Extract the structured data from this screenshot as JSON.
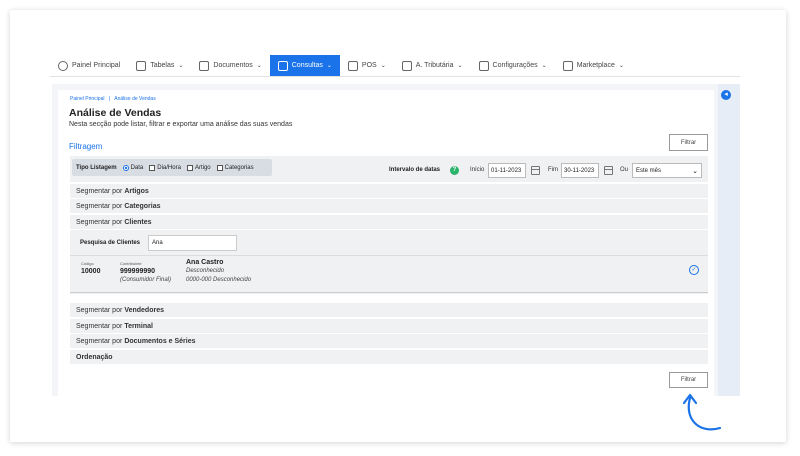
{
  "nav": {
    "items": [
      {
        "label": "Painel Principal",
        "icon": "dashboard-icon",
        "chevron": false
      },
      {
        "label": "Tabelas",
        "icon": "table-icon",
        "chevron": true
      },
      {
        "label": "Documentos",
        "icon": "document-icon",
        "chevron": true
      },
      {
        "label": "Consultas",
        "icon": "chart-icon",
        "chevron": true,
        "active": true
      },
      {
        "label": "POS",
        "icon": "pos-icon",
        "chevron": true
      },
      {
        "label": "A. Tributária",
        "icon": "tax-icon",
        "chevron": true
      },
      {
        "label": "Configurações",
        "icon": "settings-icon",
        "chevron": true
      },
      {
        "label": "Marketplace",
        "icon": "marketplace-icon",
        "chevron": true
      }
    ]
  },
  "breadcrumb": {
    "home": "Painel Principal",
    "separator": "|",
    "current": "Análise de Vendas"
  },
  "page": {
    "title": "Análise de Vendas",
    "subtitle": "Nesta secção pode listar, filtrar e exportar uma análise das suas vendas"
  },
  "buttons": {
    "filter_top": "Filtrar",
    "filter_bottom": "Filtrar"
  },
  "filter": {
    "section_title": "Filtragem",
    "tipo_label": "Tipo Listagem",
    "options": [
      {
        "label": "Data",
        "kind": "radio",
        "checked": true
      },
      {
        "label": "Dia/Hora",
        "kind": "check",
        "checked": false
      },
      {
        "label": "Artigo",
        "kind": "check",
        "checked": false
      },
      {
        "label": "Categorias",
        "kind": "check",
        "checked": false
      }
    ],
    "interval_label": "Intervalo de datas",
    "help": "?",
    "start_label": "Início",
    "start_value": "01-11-2023",
    "end_label": "Fim",
    "end_value": "30-11-2023",
    "or_label": "Ou",
    "period_value": "Este mês"
  },
  "segments": {
    "prefix": "Segmentar por",
    "artigos": "Artigos",
    "categorias": "Categorias",
    "clientes": "Clientes",
    "vendedores": "Vendedores",
    "terminal": "Terminal",
    "documentos": "Documentos e Séries",
    "ordenacao": "Ordenação"
  },
  "client_search": {
    "label": "Pesquisa de Clientes",
    "value": "Ana"
  },
  "client_result": {
    "code_label": "Código",
    "code": "10000",
    "taxpayer_label": "Contribuinte",
    "taxpayer": "999999990",
    "taxpayer_note": "(Consumidor Final)",
    "name": "Ana Castro",
    "line2": "Desconhecido",
    "line3": "0000-000 Desconhecido"
  },
  "colors": {
    "accent": "#1a73e8",
    "help": "#2ab36a"
  }
}
